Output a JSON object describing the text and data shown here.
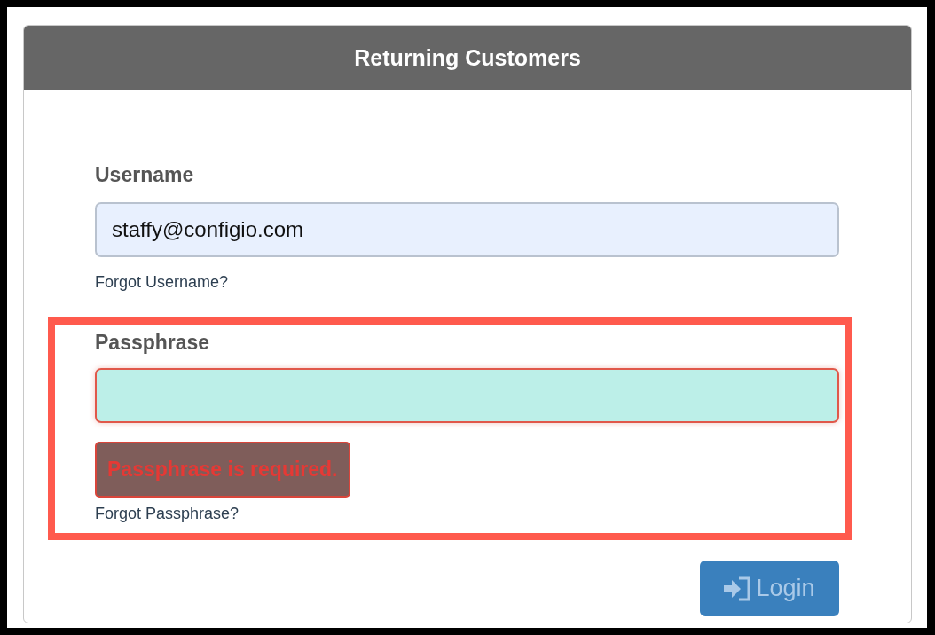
{
  "panel": {
    "title": "Returning Customers"
  },
  "fields": [
    {
      "label": "Username",
      "value": "staffy@configio.com",
      "color": "#e8f0fe",
      "invalid": false,
      "highlighted": false,
      "help_link": "Forgot Username?"
    },
    {
      "label": "Passphrase",
      "color": "#bcefe8",
      "invalid": true,
      "highlighted": true,
      "error": "Passphrase is required.",
      "help_link": "Forgot Passphrase?"
    }
  ],
  "submit": {
    "label": "Login",
    "disabled": true
  }
}
